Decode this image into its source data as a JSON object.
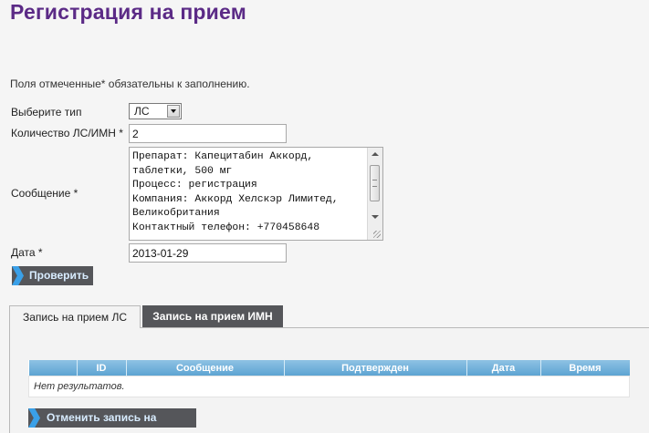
{
  "page": {
    "title": "Регистрация на прием",
    "required_note": "Поля отмеченные* обязательны к заполнению."
  },
  "form": {
    "type_label": "Выберите тип",
    "type_value": "ЛС",
    "count_label": "Количество ЛС/ИМН *",
    "count_value": "2",
    "message_label": "Сообщение *",
    "message_lines": [
      "Препарат: Капецитабин Аккорд,",
      "таблетки, 500 мг",
      "Процесс: регистрация",
      "Компания: Аккорд Хелскэр Лимитед,",
      "Великобритания",
      "Контактный телефон: +770458648"
    ],
    "date_label": "Дата *",
    "date_value": "2013-01-29",
    "check_button": "Проверить"
  },
  "tabs": [
    {
      "label": "Запись на прием ЛС",
      "active": true
    },
    {
      "label": "Запись на прием ИМН",
      "active": false
    }
  ],
  "grid": {
    "columns": [
      "",
      "ID",
      "Сообщение",
      "Подтвержден",
      "Дата",
      "Время"
    ],
    "empty_text": "Нет результатов."
  },
  "cancel_button": "Отменить запись на прием",
  "colors": {
    "title": "#5b2a86",
    "button_bg": "#55565a",
    "button_accent": "#3aa0e8",
    "grid_header": "#6eaedb"
  }
}
